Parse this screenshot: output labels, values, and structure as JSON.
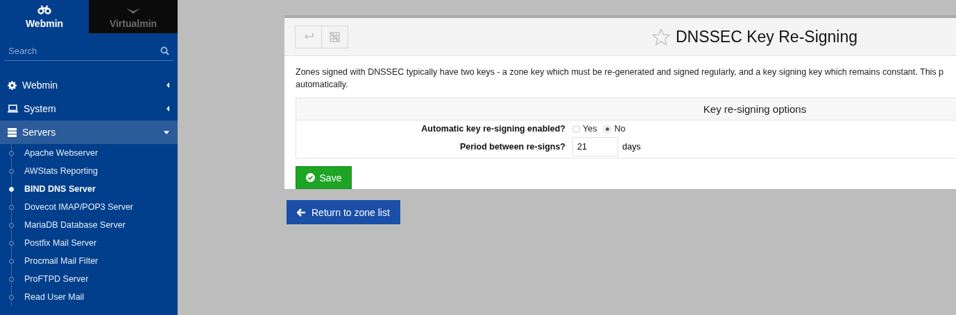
{
  "sidebar": {
    "tabs": [
      {
        "label": "Webmin",
        "selected": true
      },
      {
        "label": "Virtualmin",
        "selected": false
      }
    ],
    "search": {
      "placeholder": "Search"
    },
    "menu": [
      {
        "label": "Webmin",
        "expanded": false
      },
      {
        "label": "System",
        "expanded": false
      },
      {
        "label": "Servers",
        "expanded": true,
        "children": [
          {
            "label": "Apache Webserver",
            "selected": false
          },
          {
            "label": "AWStats Reporting",
            "selected": false
          },
          {
            "label": "BIND DNS Server",
            "selected": true
          },
          {
            "label": "Dovecot IMAP/POP3 Server",
            "selected": false
          },
          {
            "label": "MariaDB Database Server",
            "selected": false
          },
          {
            "label": "Postfix Mail Server",
            "selected": false
          },
          {
            "label": "Procmail Mail Filter",
            "selected": false
          },
          {
            "label": "ProFTPD Server",
            "selected": false
          },
          {
            "label": "Read User Mail",
            "selected": false
          }
        ]
      }
    ]
  },
  "panel": {
    "title": "DNSSEC Key Re-Signing",
    "description_lines": [
      "Zones signed with DNSSEC typically have two keys - a zone key which must be re-generated and signed regularly, and a key signing key which remains constant. This p",
      "automatically."
    ],
    "options": {
      "heading": "Key re-signing options",
      "enabled": {
        "label": "Automatic key re-signing enabled?",
        "choices": [
          {
            "label": "Yes",
            "selected": false
          },
          {
            "label": "No",
            "selected": true
          }
        ]
      },
      "period": {
        "label": "Period between re-signs?",
        "value": "21",
        "unit": "days"
      }
    },
    "save_button": "Save"
  },
  "return_button": "Return to zone list"
}
